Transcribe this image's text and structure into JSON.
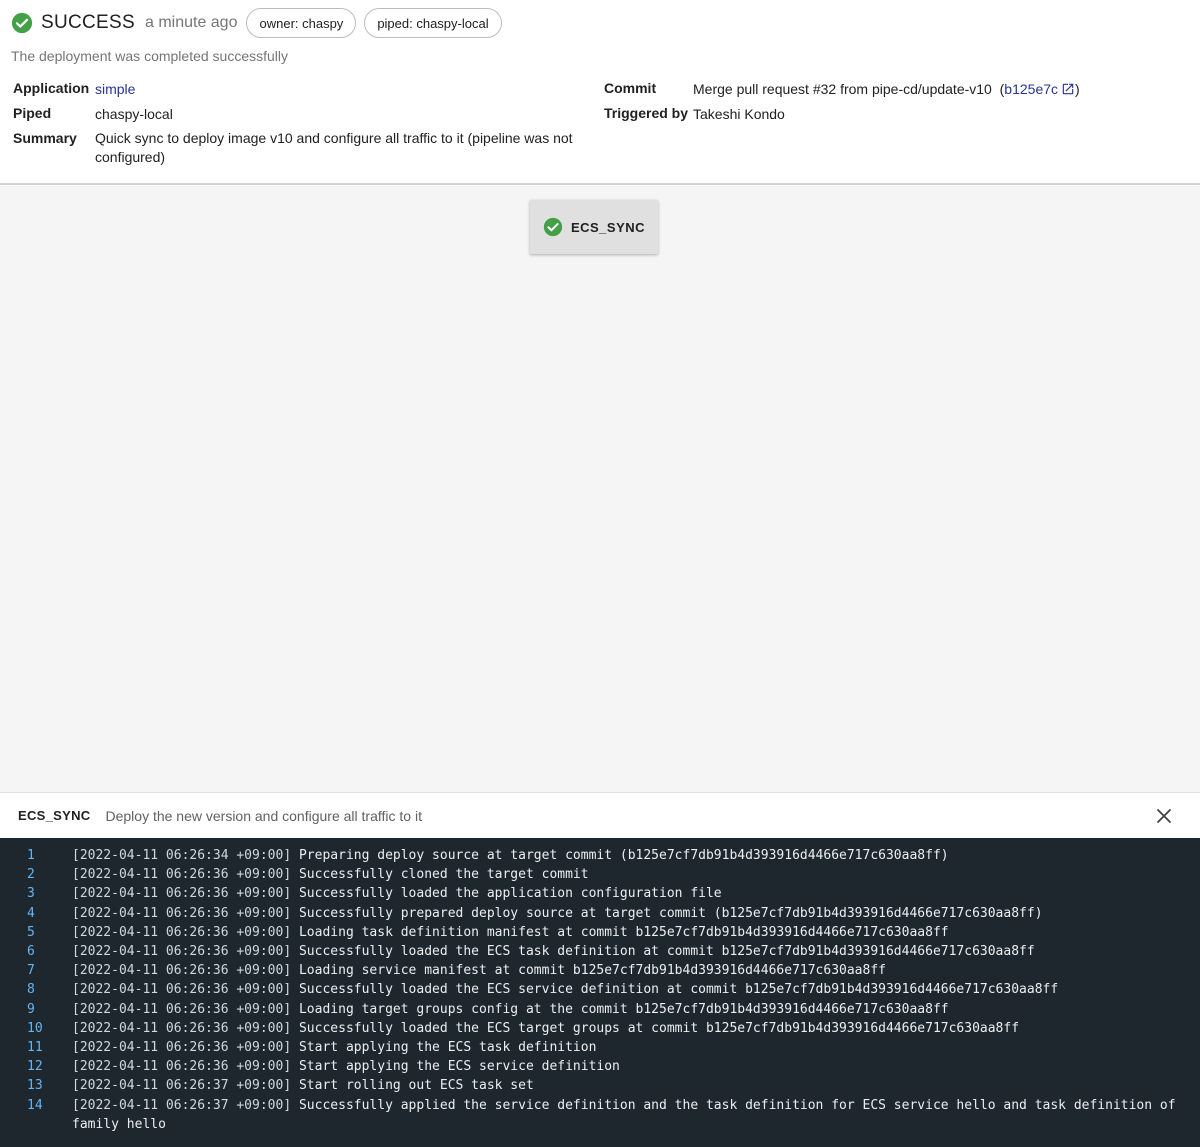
{
  "deployment": {
    "status": "SUCCESS",
    "time_ago": "a minute ago",
    "labels": [
      "owner: chaspy",
      "piped: chaspy-local"
    ],
    "description": "The deployment was completed successfully",
    "status_color": "#43a047"
  },
  "info": {
    "application_label": "Application",
    "application_value": "simple",
    "piped_label": "Piped",
    "piped_value": "chaspy-local",
    "summary_label": "Summary",
    "summary_value": "Quick sync to deploy image v10 and configure all traffic to it (pipeline was not configured)",
    "commit_label": "Commit",
    "commit_message": "Merge pull request #32 from pipe-cd/update-v10",
    "commit_hash": "b125e7c",
    "triggered_by_label": "Triggered by",
    "triggered_by_value": "Takeshi Kondo"
  },
  "pipeline": {
    "stages": [
      {
        "name": "ECS_SYNC",
        "status": "success"
      }
    ]
  },
  "log_panel": {
    "stage_name": "ECS_SYNC",
    "stage_description": "Deploy the new version and configure all traffic to it",
    "lines": [
      {
        "num": "1",
        "ts": "[2022-04-11 06:26:34 +09:00]",
        "msg": "Preparing deploy source at target commit (b125e7cf7db91b4d393916d4466e717c630aa8ff)"
      },
      {
        "num": "2",
        "ts": "[2022-04-11 06:26:36 +09:00]",
        "msg": "Successfully cloned the target commit"
      },
      {
        "num": "3",
        "ts": "[2022-04-11 06:26:36 +09:00]",
        "msg": "Successfully loaded the application configuration file"
      },
      {
        "num": "4",
        "ts": "[2022-04-11 06:26:36 +09:00]",
        "msg": "Successfully prepared deploy source at target commit (b125e7cf7db91b4d393916d4466e717c630aa8ff)"
      },
      {
        "num": "5",
        "ts": "[2022-04-11 06:26:36 +09:00]",
        "msg": "Loading task definition manifest at commit b125e7cf7db91b4d393916d4466e717c630aa8ff"
      },
      {
        "num": "6",
        "ts": "[2022-04-11 06:26:36 +09:00]",
        "msg": "Successfully loaded the ECS task definition at commit b125e7cf7db91b4d393916d4466e717c630aa8ff"
      },
      {
        "num": "7",
        "ts": "[2022-04-11 06:26:36 +09:00]",
        "msg": "Loading service manifest at commit b125e7cf7db91b4d393916d4466e717c630aa8ff"
      },
      {
        "num": "8",
        "ts": "[2022-04-11 06:26:36 +09:00]",
        "msg": "Successfully loaded the ECS service definition at commit b125e7cf7db91b4d393916d4466e717c630aa8ff"
      },
      {
        "num": "9",
        "ts": "[2022-04-11 06:26:36 +09:00]",
        "msg": "Loading target groups config at the commit b125e7cf7db91b4d393916d4466e717c630aa8ff"
      },
      {
        "num": "10",
        "ts": "[2022-04-11 06:26:36 +09:00]",
        "msg": "Successfully loaded the ECS target groups at commit b125e7cf7db91b4d393916d4466e717c630aa8ff"
      },
      {
        "num": "11",
        "ts": "[2022-04-11 06:26:36 +09:00]",
        "msg": "Start applying the ECS task definition"
      },
      {
        "num": "12",
        "ts": "[2022-04-11 06:26:36 +09:00]",
        "msg": "Start applying the ECS service definition"
      },
      {
        "num": "13",
        "ts": "[2022-04-11 06:26:37 +09:00]",
        "msg": "Start rolling out ECS task set"
      },
      {
        "num": "14",
        "ts": "[2022-04-11 06:26:37 +09:00]",
        "msg": "Successfully applied the service definition and the task definition for ECS service hello and task definition of family hello"
      }
    ]
  }
}
